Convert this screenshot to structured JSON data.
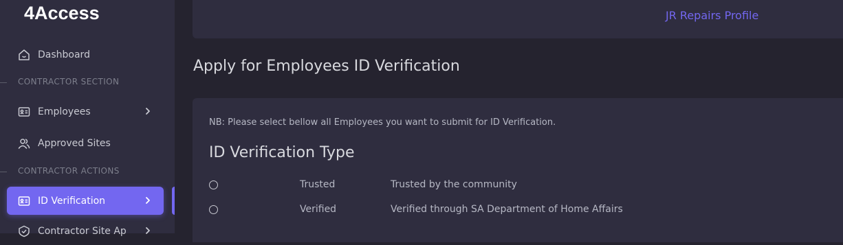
{
  "app": {
    "brand": "4Access"
  },
  "sidebar": {
    "dashboard": "Dashboard",
    "section_contractor": "CONTRACTOR SECTION",
    "employees": "Employees",
    "approved_sites": "Approved Sites",
    "section_actions": "CONTRACTOR ACTIONS",
    "id_verification": "ID Verification",
    "contractor_site": "Contractor Site Ap"
  },
  "header": {
    "profile_link": "JR Repairs Profile"
  },
  "main": {
    "heading": "Apply for Employees ID Verification",
    "note": "NB: Please select bellow all Employees you want to submit for ID Verification.",
    "type_title": "ID Verification Type",
    "options": [
      {
        "name": "Trusted",
        "description": "Trusted by the community"
      },
      {
        "name": "Verified",
        "description": "Verified through SA Department of Home Affairs"
      }
    ]
  },
  "colors": {
    "accent": "#7367f0",
    "sidebar_bg": "#2f2d3f",
    "page_bg": "#25232f"
  }
}
